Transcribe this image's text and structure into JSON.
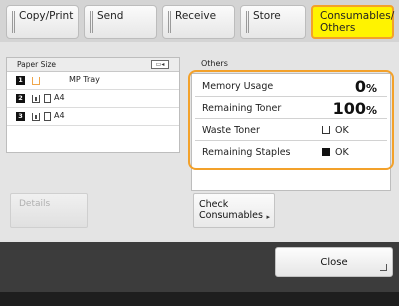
{
  "tabs": [
    {
      "label": "Copy/Print",
      "line2": ""
    },
    {
      "label": "Send",
      "line2": ""
    },
    {
      "label": "Receive",
      "line2": ""
    },
    {
      "label": "Store",
      "line2": ""
    },
    {
      "label": "Consumables/",
      "line2": "Others",
      "active": true
    }
  ],
  "paper": {
    "header": "Paper Size",
    "rows": [
      {
        "num": "1",
        "label": "MP Tray"
      },
      {
        "num": "2",
        "label": "A4"
      },
      {
        "num": "3",
        "label": "A4"
      }
    ]
  },
  "details_label": "Details",
  "others": {
    "title": "Others",
    "memory_usage": {
      "label": "Memory Usage",
      "value": "0",
      "unit": "%"
    },
    "remaining_toner": {
      "label": "Remaining Toner",
      "value": "100",
      "unit": "%"
    },
    "waste_toner": {
      "label": "Waste Toner",
      "status": "OK"
    },
    "remaining_staples": {
      "label": "Remaining Staples",
      "status": "OK"
    }
  },
  "check": {
    "line1": "Check",
    "line2": "Consumables"
  },
  "close_label": "Close",
  "colors": {
    "active_tab": "#fff300",
    "highlight": "#f3a12a"
  }
}
